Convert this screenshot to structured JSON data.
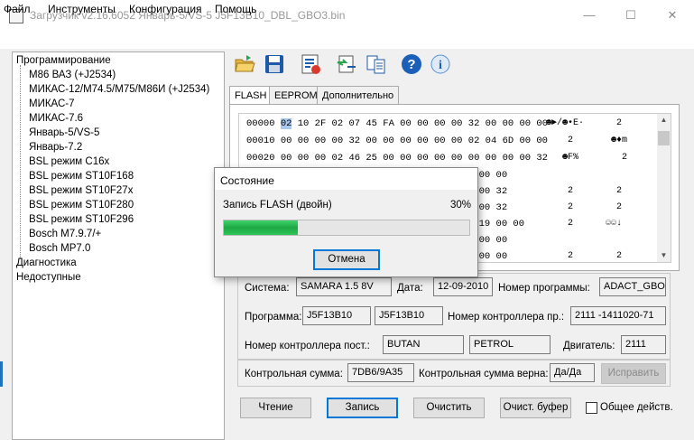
{
  "window": {
    "title": "Загрузчик v2.16.6052 Январь-5/VS-5 J5F13B10_DBL_GBO3.bin",
    "minimize": "—",
    "maximize": "☐",
    "close": "✕"
  },
  "menu": [
    "Файл",
    "Инструменты",
    "Конфигурация",
    "Помощь"
  ],
  "tree": {
    "root": "Программирование",
    "children": [
      "M86 ВАЗ (+J2534)",
      "МИКАС-12/M74.5/M75/M86И (+J2534)",
      "МИКАС-7",
      "МИКАС-7.6",
      "Январь-5/VS-5",
      "Январь-7.2",
      "BSL режим C16x",
      "BSL режим ST10F168",
      "BSL режим ST10F27x",
      "BSL режим ST10F280",
      "BSL режим ST10F296",
      "Bosch M7.9.7/+",
      "Bosch MP7.0"
    ],
    "other": [
      "Диагностика",
      "Недоступные"
    ]
  },
  "toolbar": {
    "icons": [
      "open-folder-icon",
      "save-disk-icon",
      "checklist-icon",
      "transfer-icon",
      "compare-icon",
      "help-icon",
      "info-icon"
    ],
    "colors": {
      "folder": "#e8b640",
      "blue": "#1e5aa8",
      "green": "#2aa44a",
      "help": "#1c5fb8"
    }
  },
  "tabs": [
    "FLASH",
    "EEPROM",
    "Дополнительно"
  ],
  "hex": {
    "rows": [
      {
        "addr": "00000",
        "sel": "02",
        "bytes": "10 2F 02 07 45 FA 00 00 00 00 32 00 00 00 00",
        "ascii": "☻►/☻•E·      2"
      },
      {
        "addr": "00010",
        "sel": "",
        "bytes": "00 00 00 00 32 00 00 00 00 00 00 02 04 6D 00 00",
        "ascii": "    2       ☻♦m"
      },
      {
        "addr": "00020",
        "sel": "",
        "bytes": "00 00 00 02 46 25 00 00 00 00 00 00 00 00 00 32",
        "ascii": "   ☻F%        2"
      },
      {
        "addr": "",
        "sel": "",
        "bytes": "            00 00",
        "ascii": ""
      },
      {
        "addr": "",
        "sel": "",
        "bytes": "            00 32",
        "ascii": "    2        2"
      },
      {
        "addr": "",
        "sel": "",
        "bytes": "            00 32",
        "ascii": "    2        2"
      },
      {
        "addr": "",
        "sel": "",
        "bytes": "          1 19 00 00",
        "ascii": "    2      ☺☺↓"
      },
      {
        "addr": "",
        "sel": "",
        "bytes": "            00 00",
        "ascii": ""
      },
      {
        "addr": "",
        "sel": "",
        "bytes": "            00 00",
        "ascii": "    2        2"
      }
    ]
  },
  "info": {
    "system_label": "Система:",
    "system": "SAMARA 1.5 8V",
    "date_label": "Дата:",
    "date": "12-09-2010",
    "progno_label": "Номер программы:",
    "progno": "ADACT_GBO3",
    "program_label": "Программа:",
    "program1": "J5F13B10",
    "program2": "J5F13B10",
    "ctrl_pr_label": "Номер контроллера пр.:",
    "ctrl_pr": "2111 -1411020-71",
    "ctrl_post_label": "Номер контроллера пост.:",
    "ctrl_post1": "BUTAN",
    "ctrl_post2": "PETROL",
    "engine_label": "Двигатель:",
    "engine": "2111",
    "checksum_label": "Контрольная сумма:",
    "checksum": "7DB6/9A35",
    "checksum_ok_label": "Контрольная сумма верна:",
    "checksum_ok": "Да/Да",
    "fix_button": "Исправить"
  },
  "buttons": {
    "read": "Чтение",
    "write": "Запись",
    "clear": "Очистить",
    "clear_buffer": "Очист. буфер",
    "common_actions": "Общее действ."
  },
  "dialog": {
    "title": "Состояние",
    "message": "Запись FLASH (двойн)",
    "percent_text": "30%",
    "progress": 0.3,
    "cancel": "Отмена"
  }
}
